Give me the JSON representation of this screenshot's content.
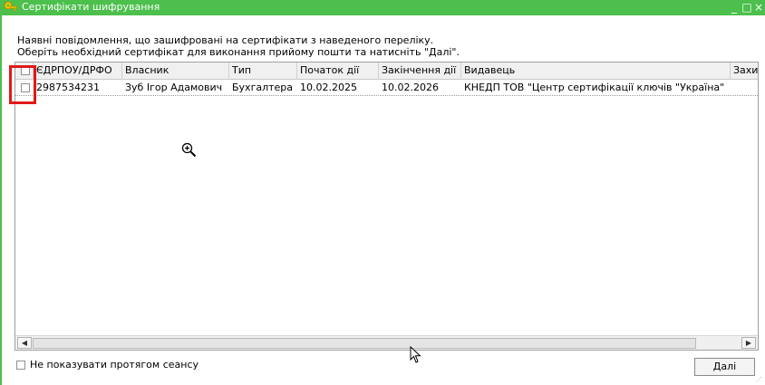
{
  "window": {
    "title": "Сертифікати шифрування",
    "controls": {
      "minimize": "_",
      "maximize": "□",
      "close": "×"
    }
  },
  "instructions": {
    "line1": "Наявні повідомлення, що зашифровані на сертифікати з наведеного переліку.",
    "line2": "Оберіть необхідний сертифікат для виконання прийому пошти та натисніть \"Далі\"."
  },
  "table": {
    "columns": [
      "ЄДРПОУ/ДРФО",
      "Власник",
      "Тип",
      "Початок дії",
      "Закінчення дії",
      "Видавець",
      "Захи"
    ],
    "rows": [
      {
        "checked": false,
        "edrpou": "2987534231",
        "owner": "Зуб Ігор Адамович",
        "type": "Бухгалтера",
        "start": "10.02.2025",
        "end": "10.02.2026",
        "issuer": "КНЕДП ТОВ \"Центр сертифікації ключів \"Україна\"",
        "extra": ""
      }
    ]
  },
  "icons": {
    "app": "key-icon",
    "zoom_cursor": "zoom-in-icon",
    "pointer_cursor": "arrow-cursor-icon"
  },
  "footer": {
    "dont_show_label": "Не показувати протягом сеансу",
    "dont_show_checked": false,
    "next_button": "Далі"
  },
  "colors": {
    "title_bar": "#4cbf4c",
    "highlight": "#e01919"
  }
}
